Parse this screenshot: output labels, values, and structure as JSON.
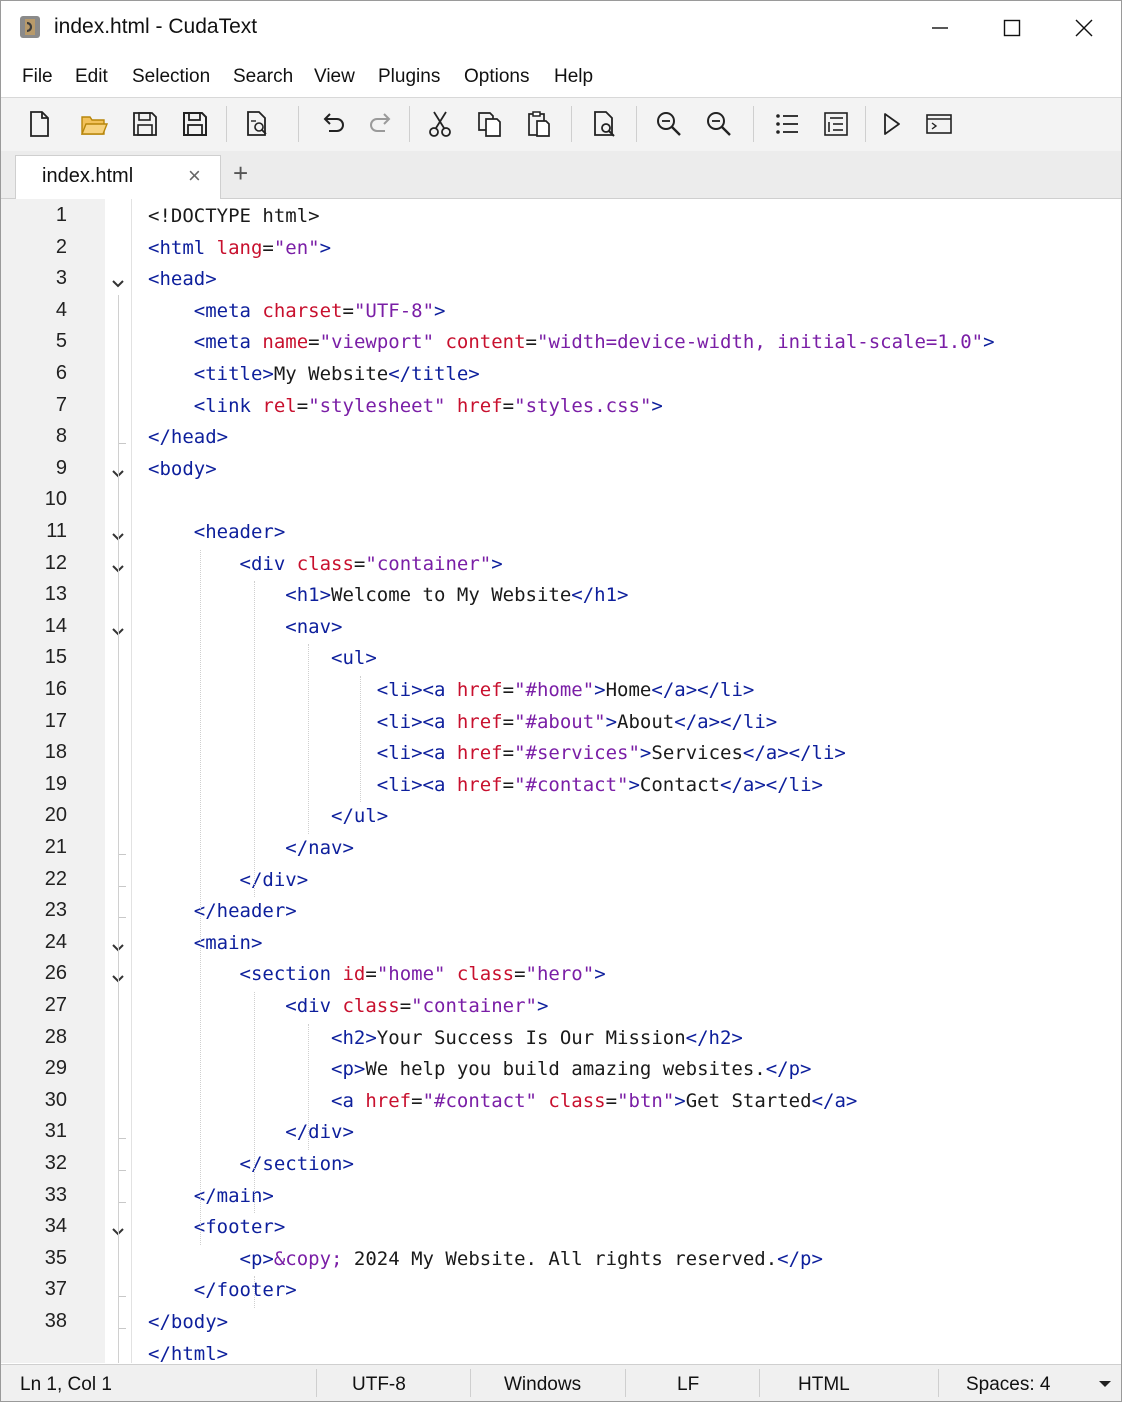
{
  "window": {
    "title": "index.html - CudaText",
    "app_icon": "cudatext-logo-icon"
  },
  "menu": [
    "File",
    "Edit",
    "Selection",
    "Search",
    "View",
    "Plugins",
    "Options",
    "Help"
  ],
  "toolbar": {
    "buttons": [
      "new-file-icon",
      "open-folder-icon",
      "save-icon",
      "save-all-icon",
      "print-preview-icon",
      "undo-icon",
      "redo-icon",
      "cut-icon",
      "copy-icon",
      "paste-icon",
      "find-icon",
      "zoom-in-icon",
      "zoom-out-icon",
      "list-icon",
      "indent-list-icon",
      "run-icon",
      "console-icon"
    ]
  },
  "tabs": {
    "active_label": "index.html",
    "close_glyph": "×",
    "add_glyph": "+"
  },
  "editor": {
    "lines": [
      {
        "n": "1",
        "fold": "none",
        "tokens": [
          [
            "x",
            "<!DOCTYPE html>"
          ]
        ]
      },
      {
        "n": "2",
        "fold": "none",
        "tokens": [
          [
            "t",
            "<html "
          ],
          [
            "a",
            "lang"
          ],
          [
            "x",
            "="
          ],
          [
            "v",
            "\"en\""
          ],
          [
            "t",
            ">"
          ]
        ]
      },
      {
        "n": "3",
        "fold": "open",
        "tokens": [
          [
            "t",
            "<head>"
          ]
        ]
      },
      {
        "n": "4",
        "fold": "none",
        "tokens": [
          [
            "x",
            "    "
          ],
          [
            "t",
            "<meta "
          ],
          [
            "a",
            "charset"
          ],
          [
            "x",
            "="
          ],
          [
            "v",
            "\"UTF-8\""
          ],
          [
            "t",
            ">"
          ]
        ]
      },
      {
        "n": "5",
        "fold": "none",
        "tokens": [
          [
            "x",
            "    "
          ],
          [
            "t",
            "<meta "
          ],
          [
            "a",
            "name"
          ],
          [
            "x",
            "="
          ],
          [
            "v",
            "\"viewport\" "
          ],
          [
            "a",
            "content"
          ],
          [
            "x",
            "="
          ],
          [
            "v",
            "\"width=device-width, initial-scale=1.0\""
          ],
          [
            "t",
            ">"
          ]
        ]
      },
      {
        "n": "6",
        "fold": "none",
        "tokens": [
          [
            "x",
            "    "
          ],
          [
            "t",
            "<title>"
          ],
          [
            "x",
            "My Website"
          ],
          [
            "t",
            "</title>"
          ]
        ]
      },
      {
        "n": "7",
        "fold": "none",
        "tokens": [
          [
            "x",
            "    "
          ],
          [
            "t",
            "<link "
          ],
          [
            "a",
            "rel"
          ],
          [
            "x",
            "="
          ],
          [
            "v",
            "\"stylesheet\" "
          ],
          [
            "a",
            "href"
          ],
          [
            "x",
            "="
          ],
          [
            "v",
            "\"styles.css\""
          ],
          [
            "t",
            ">"
          ]
        ]
      },
      {
        "n": "8",
        "fold": "end",
        "tokens": [
          [
            "t",
            "</head>"
          ]
        ]
      },
      {
        "n": "9",
        "fold": "open",
        "tokens": [
          [
            "t",
            "<body>"
          ]
        ]
      },
      {
        "n": "10",
        "fold": "none",
        "tokens": []
      },
      {
        "n": "11",
        "fold": "open",
        "tokens": [
          [
            "x",
            "    "
          ],
          [
            "t",
            "<header>"
          ]
        ]
      },
      {
        "n": "12",
        "fold": "open",
        "tokens": [
          [
            "x",
            "        "
          ],
          [
            "t",
            "<div "
          ],
          [
            "a",
            "class"
          ],
          [
            "x",
            "="
          ],
          [
            "v",
            "\"container\""
          ],
          [
            "t",
            ">"
          ]
        ]
      },
      {
        "n": "13",
        "fold": "none",
        "tokens": [
          [
            "x",
            "            "
          ],
          [
            "t",
            "<h1>"
          ],
          [
            "x",
            "Welcome to My Website"
          ],
          [
            "t",
            "</h1>"
          ]
        ]
      },
      {
        "n": "14",
        "fold": "open",
        "tokens": [
          [
            "x",
            "            "
          ],
          [
            "t",
            "<nav>"
          ]
        ]
      },
      {
        "n": "15",
        "fold": "none",
        "tokens": [
          [
            "x",
            "                "
          ],
          [
            "t",
            "<ul>"
          ]
        ]
      },
      {
        "n": "16",
        "fold": "none",
        "tokens": [
          [
            "x",
            "                    "
          ],
          [
            "t",
            "<li><a "
          ],
          [
            "a",
            "href"
          ],
          [
            "x",
            "="
          ],
          [
            "v",
            "\"#home\""
          ],
          [
            "t",
            ">"
          ],
          [
            "x",
            "Home"
          ],
          [
            "t",
            "</a></li>"
          ]
        ]
      },
      {
        "n": "17",
        "fold": "none",
        "tokens": [
          [
            "x",
            "                    "
          ],
          [
            "t",
            "<li><a "
          ],
          [
            "a",
            "href"
          ],
          [
            "x",
            "="
          ],
          [
            "v",
            "\"#about\""
          ],
          [
            "t",
            ">"
          ],
          [
            "x",
            "About"
          ],
          [
            "t",
            "</a></li>"
          ]
        ]
      },
      {
        "n": "18",
        "fold": "none",
        "tokens": [
          [
            "x",
            "                    "
          ],
          [
            "t",
            "<li><a "
          ],
          [
            "a",
            "href"
          ],
          [
            "x",
            "="
          ],
          [
            "v",
            "\"#services\""
          ],
          [
            "t",
            ">"
          ],
          [
            "x",
            "Services"
          ],
          [
            "t",
            "</a></li>"
          ]
        ]
      },
      {
        "n": "19",
        "fold": "none",
        "tokens": [
          [
            "x",
            "                    "
          ],
          [
            "t",
            "<li><a "
          ],
          [
            "a",
            "href"
          ],
          [
            "x",
            "="
          ],
          [
            "v",
            "\"#contact\""
          ],
          [
            "t",
            ">"
          ],
          [
            "x",
            "Contact"
          ],
          [
            "t",
            "</a></li>"
          ]
        ]
      },
      {
        "n": "20",
        "fold": "none",
        "tokens": [
          [
            "x",
            "                "
          ],
          [
            "t",
            "</ul>"
          ]
        ]
      },
      {
        "n": "21",
        "fold": "end",
        "tokens": [
          [
            "x",
            "            "
          ],
          [
            "t",
            "</nav>"
          ]
        ]
      },
      {
        "n": "22",
        "fold": "end",
        "tokens": [
          [
            "x",
            "        "
          ],
          [
            "t",
            "</div>"
          ]
        ]
      },
      {
        "n": "23",
        "fold": "end",
        "tokens": [
          [
            "x",
            "    "
          ],
          [
            "t",
            "</header>"
          ]
        ]
      },
      {
        "n": "24",
        "fold": "open",
        "tokens": [
          [
            "x",
            "    "
          ],
          [
            "t",
            "<main>"
          ]
        ]
      },
      {
        "n": "26",
        "fold": "open",
        "tokens": [
          [
            "x",
            "        "
          ],
          [
            "t",
            "<section "
          ],
          [
            "a",
            "id"
          ],
          [
            "x",
            "="
          ],
          [
            "v",
            "\"home\" "
          ],
          [
            "a",
            "class"
          ],
          [
            "x",
            "="
          ],
          [
            "v",
            "\"hero\""
          ],
          [
            "t",
            ">"
          ]
        ]
      },
      {
        "n": "27",
        "fold": "none",
        "tokens": [
          [
            "x",
            "            "
          ],
          [
            "t",
            "<div "
          ],
          [
            "a",
            "class"
          ],
          [
            "x",
            "="
          ],
          [
            "v",
            "\"container\""
          ],
          [
            "t",
            ">"
          ]
        ]
      },
      {
        "n": "28",
        "fold": "none",
        "tokens": [
          [
            "x",
            "                "
          ],
          [
            "t",
            "<h2>"
          ],
          [
            "x",
            "Your Success Is Our Mission"
          ],
          [
            "t",
            "</h2>"
          ]
        ]
      },
      {
        "n": "29",
        "fold": "none",
        "tokens": [
          [
            "x",
            "                "
          ],
          [
            "t",
            "<p>"
          ],
          [
            "x",
            "We help you build amazing websites."
          ],
          [
            "t",
            "</p>"
          ]
        ]
      },
      {
        "n": "30",
        "fold": "none",
        "tokens": [
          [
            "x",
            "                "
          ],
          [
            "t",
            "<a "
          ],
          [
            "a",
            "href"
          ],
          [
            "x",
            "="
          ],
          [
            "v",
            "\"#contact\" "
          ],
          [
            "a",
            "class"
          ],
          [
            "x",
            "="
          ],
          [
            "v",
            "\"btn\""
          ],
          [
            "t",
            ">"
          ],
          [
            "x",
            "Get Started"
          ],
          [
            "t",
            "</a>"
          ]
        ]
      },
      {
        "n": "31",
        "fold": "end",
        "tokens": [
          [
            "x",
            "            "
          ],
          [
            "t",
            "</div>"
          ]
        ]
      },
      {
        "n": "32",
        "fold": "end",
        "tokens": [
          [
            "x",
            "        "
          ],
          [
            "t",
            "</section>"
          ]
        ]
      },
      {
        "n": "33",
        "fold": "end",
        "tokens": [
          [
            "x",
            "    "
          ],
          [
            "t",
            "</main>"
          ]
        ]
      },
      {
        "n": "34",
        "fold": "open",
        "tokens": [
          [
            "x",
            "    "
          ],
          [
            "t",
            "<footer>"
          ]
        ]
      },
      {
        "n": "35",
        "fold": "none",
        "tokens": [
          [
            "x",
            "        "
          ],
          [
            "t",
            "<p>"
          ],
          [
            "v",
            "&copy;"
          ],
          [
            "x",
            " 2024 My Website. All rights reserved."
          ],
          [
            "t",
            "</p>"
          ]
        ]
      },
      {
        "n": "37",
        "fold": "end",
        "tokens": [
          [
            "x",
            "    "
          ],
          [
            "t",
            "</footer>"
          ]
        ]
      },
      {
        "n": "38",
        "fold": "end",
        "tokens": [
          [
            "t",
            "</body>"
          ]
        ]
      },
      {
        "n": "",
        "fold": "none",
        "tokens": [
          [
            "t",
            "</html>"
          ]
        ]
      }
    ]
  },
  "status": {
    "position": "Ln 1, Col 1",
    "encoding": "UTF-8",
    "line_ending_os": "Windows",
    "line_ending": "LF",
    "lexer": "HTML",
    "indent": "Spaces: 4"
  },
  "colors": {
    "tag": "#0d1f9c",
    "attribute": "#c8102e",
    "value": "#7a1ea6",
    "text": "#1a1a1a"
  }
}
